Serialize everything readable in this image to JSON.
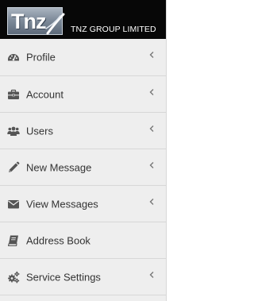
{
  "brand": {
    "logo_text": "Tnz",
    "name": "TNZ GROUP LIMITED"
  },
  "colors": {
    "header_bg": "#070707",
    "sidebar_bg": "#eeeeee",
    "divider": "#d7d7d7",
    "text": "#333333",
    "icon": "#555555",
    "chevron": "#777777"
  },
  "nav": {
    "items": [
      {
        "label": "Profile",
        "icon": "dashboard-icon",
        "has_submenu": true
      },
      {
        "label": "Account",
        "icon": "briefcase-icon",
        "has_submenu": true
      },
      {
        "label": "Users",
        "icon": "users-icon",
        "has_submenu": true
      },
      {
        "label": "New Message",
        "icon": "pencil-icon",
        "has_submenu": true
      },
      {
        "label": "View Messages",
        "icon": "envelope-icon",
        "has_submenu": true
      },
      {
        "label": "Address Book",
        "icon": "book-icon",
        "has_submenu": false
      },
      {
        "label": "Service Settings",
        "icon": "cogs-icon",
        "has_submenu": true
      }
    ]
  }
}
